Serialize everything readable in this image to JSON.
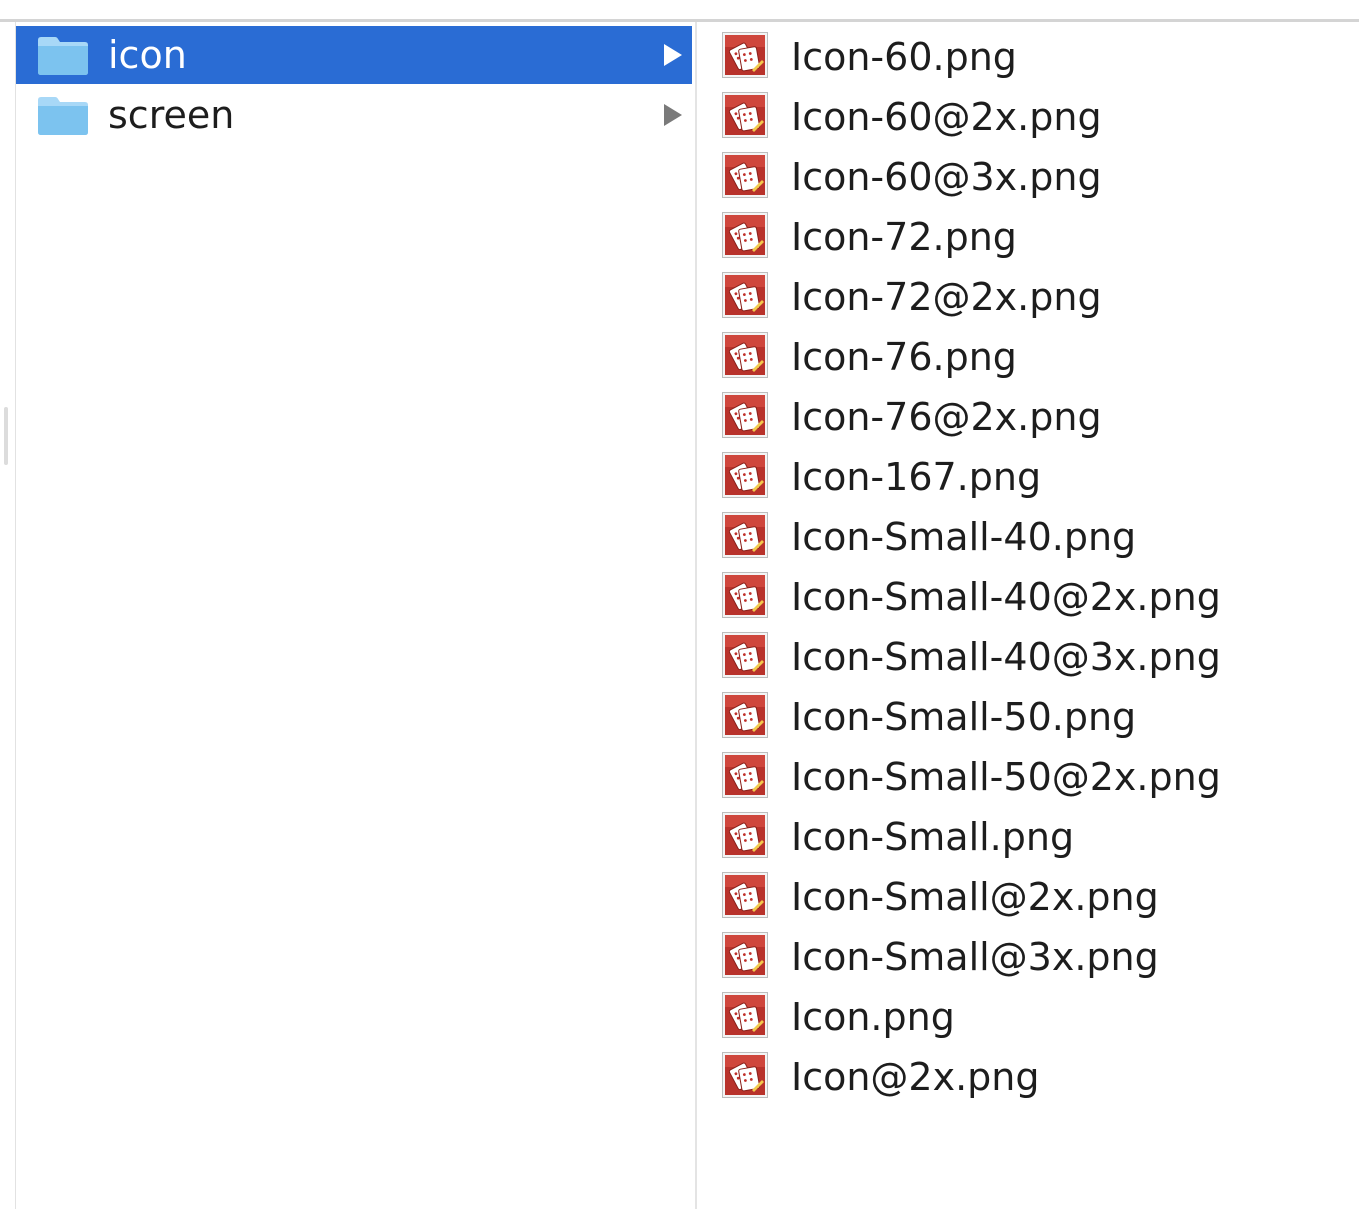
{
  "folders": [
    {
      "label": "icon",
      "selected": true,
      "icon": "folder-icon",
      "expand_icon": "chevron-right-icon"
    },
    {
      "label": "screen",
      "selected": false,
      "icon": "folder-icon",
      "expand_icon": "chevron-right-icon"
    }
  ],
  "files": [
    {
      "label": "Icon-60.png",
      "icon": "png-image-icon"
    },
    {
      "label": "Icon-60@2x.png",
      "icon": "png-image-icon"
    },
    {
      "label": "Icon-60@3x.png",
      "icon": "png-image-icon"
    },
    {
      "label": "Icon-72.png",
      "icon": "png-image-icon"
    },
    {
      "label": "Icon-72@2x.png",
      "icon": "png-image-icon"
    },
    {
      "label": "Icon-76.png",
      "icon": "png-image-icon"
    },
    {
      "label": "Icon-76@2x.png",
      "icon": "png-image-icon"
    },
    {
      "label": "Icon-167.png",
      "icon": "png-image-icon"
    },
    {
      "label": "Icon-Small-40.png",
      "icon": "png-image-icon"
    },
    {
      "label": "Icon-Small-40@2x.png",
      "icon": "png-image-icon"
    },
    {
      "label": "Icon-Small-40@3x.png",
      "icon": "png-image-icon"
    },
    {
      "label": "Icon-Small-50.png",
      "icon": "png-image-icon"
    },
    {
      "label": "Icon-Small-50@2x.png",
      "icon": "png-image-icon"
    },
    {
      "label": "Icon-Small.png",
      "icon": "png-image-icon"
    },
    {
      "label": "Icon-Small@2x.png",
      "icon": "png-image-icon"
    },
    {
      "label": "Icon-Small@3x.png",
      "icon": "png-image-icon"
    },
    {
      "label": "Icon.png",
      "icon": "png-image-icon"
    },
    {
      "label": "Icon@2x.png",
      "icon": "png-image-icon"
    }
  ],
  "colors": {
    "selection": "#2a6cd4",
    "folder": "#8fcdf3",
    "file_icon_red": "#c0302a",
    "text": "#1d1d1d"
  }
}
